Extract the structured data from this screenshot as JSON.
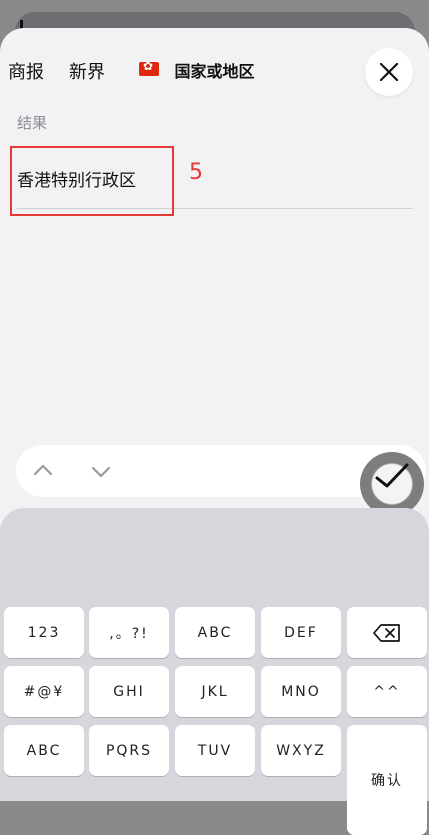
{
  "sheet": {
    "title": "国家或地区",
    "result_label": "结果",
    "result_value": "香港特别行政区",
    "annotation_number": "5"
  },
  "suggestions": [
    "商报",
    "新界"
  ],
  "keys": [
    [
      "123",
      ",。?!",
      "ABC",
      "DEF"
    ],
    [
      "#@¥",
      "GHI",
      "JKL",
      "MNO",
      "^^"
    ],
    [
      "ABC",
      "PQRS",
      "TUV",
      "WXYZ",
      "确认"
    ]
  ],
  "icons": {
    "close": "close-icon",
    "delete": "backspace-icon",
    "up": "chevron-up-icon",
    "down": "chevron-down-icon",
    "confirm": "checkmark-icon",
    "flag": "hong-kong-flag-icon"
  }
}
